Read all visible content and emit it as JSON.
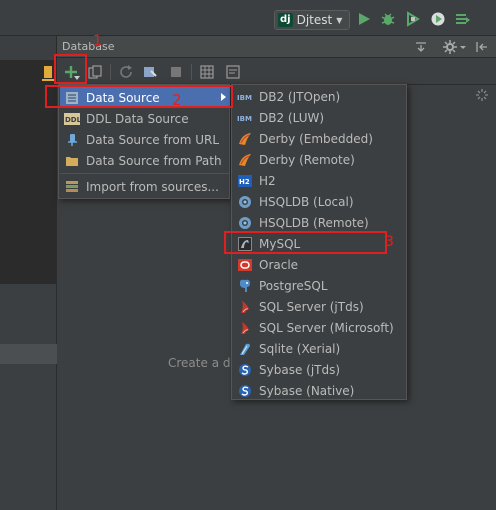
{
  "toolbar": {
    "run_config_badge": "dj",
    "run_config_name": "Djtest"
  },
  "panel": {
    "title": "Database",
    "placeholder": "Create a da"
  },
  "menu": {
    "items": [
      {
        "label": "Data Source",
        "icon": "data-source-icon",
        "selected": true,
        "has_submenu": true
      },
      {
        "label": "DDL Data Source",
        "icon": "ddl-icon"
      },
      {
        "label": "Data Source from URL",
        "icon": "url-icon"
      },
      {
        "label": "Data Source from Path",
        "icon": "folder-icon"
      },
      {
        "label": "Import from sources...",
        "icon": "import-icon"
      }
    ]
  },
  "submenu": {
    "items": [
      {
        "label": "DB2 (JTOpen)",
        "icon": "ibm-icon",
        "icon_text": "IBM"
      },
      {
        "label": "DB2 (LUW)",
        "icon": "ibm-icon",
        "icon_text": "IBM"
      },
      {
        "label": "Derby (Embedded)",
        "icon": "derby-icon"
      },
      {
        "label": "Derby (Remote)",
        "icon": "derby-icon"
      },
      {
        "label": "H2",
        "icon": "h2-icon",
        "icon_text": "H2"
      },
      {
        "label": "HSQLDB (Local)",
        "icon": "hsqldb-icon"
      },
      {
        "label": "HSQLDB (Remote)",
        "icon": "hsqldb-icon"
      },
      {
        "label": "MySQL",
        "icon": "mysql-icon"
      },
      {
        "label": "Oracle",
        "icon": "oracle-icon"
      },
      {
        "label": "PostgreSQL",
        "icon": "postgresql-icon"
      },
      {
        "label": "SQL Server (jTds)",
        "icon": "sqlserver-icon"
      },
      {
        "label": "SQL Server (Microsoft)",
        "icon": "sqlserver-icon"
      },
      {
        "label": "Sqlite (Xerial)",
        "icon": "sqlite-icon"
      },
      {
        "label": "Sybase (jTds)",
        "icon": "sybase-icon"
      },
      {
        "label": "Sybase (Native)",
        "icon": "sybase-icon"
      }
    ]
  },
  "annotations": [
    "1",
    "2",
    "3"
  ],
  "colors": {
    "selection": "#4b6eaf",
    "annotation": "#e02020",
    "add_green": "#59a869",
    "run_green": "#59a869"
  }
}
